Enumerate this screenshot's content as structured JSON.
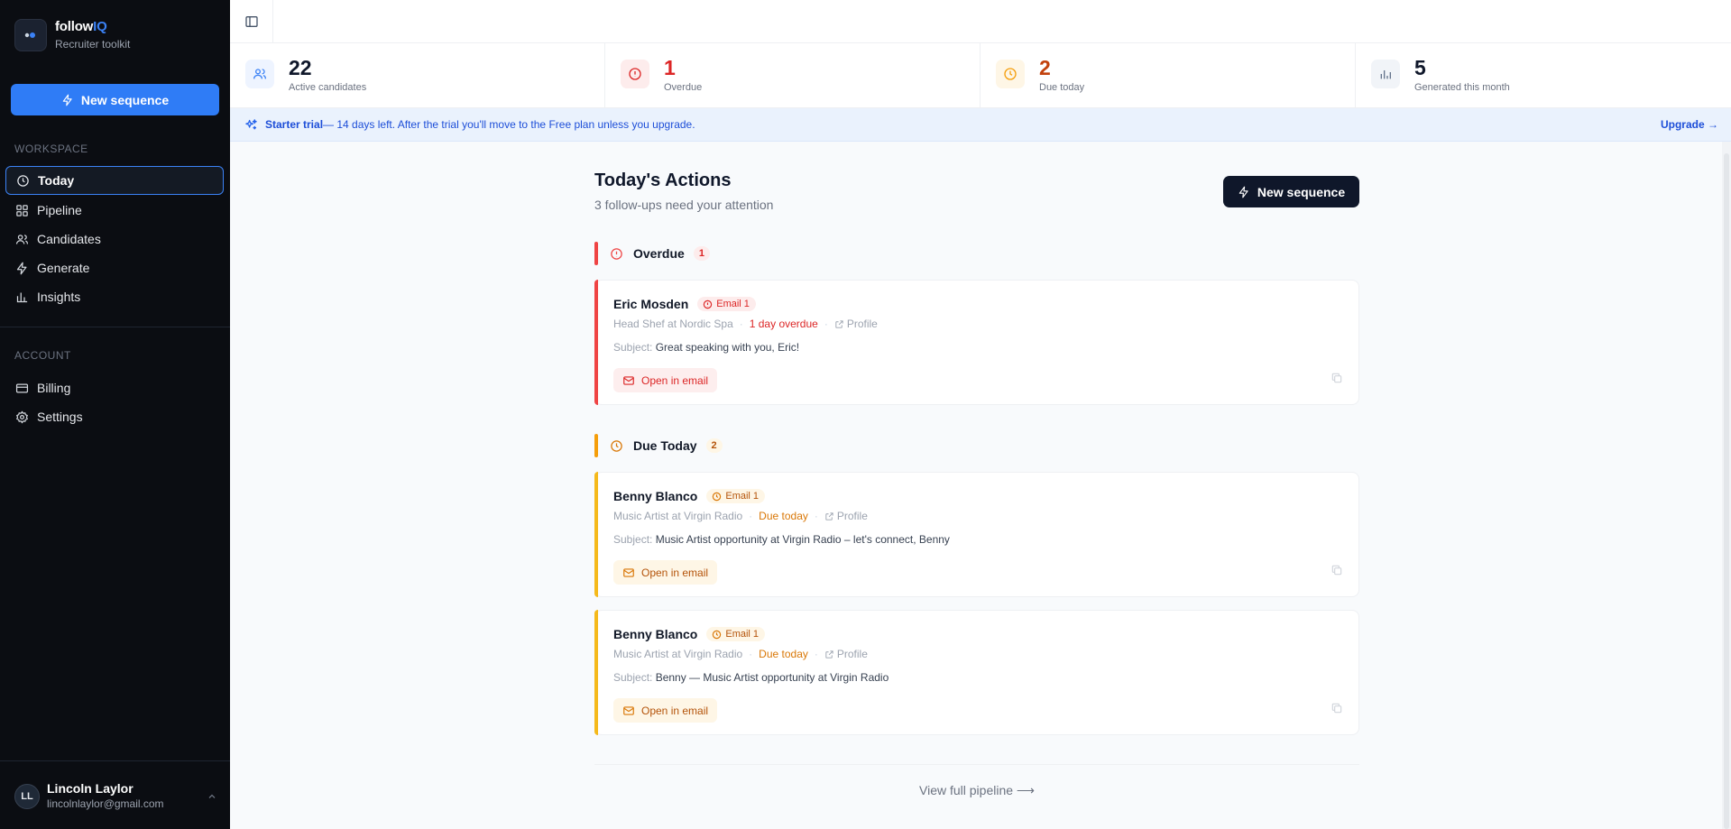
{
  "brand": {
    "name_prefix": "follow",
    "name_suffix": "IQ",
    "subtitle": "Recruiter toolkit"
  },
  "sidebar": {
    "new_sequence_label": "New sequence",
    "workspace_label": "WORKSPACE",
    "workspace_items": [
      {
        "label": "Today",
        "icon": "clock-icon",
        "active": true
      },
      {
        "label": "Pipeline",
        "icon": "grid-icon"
      },
      {
        "label": "Candidates",
        "icon": "users-icon"
      },
      {
        "label": "Generate",
        "icon": "bolt-icon"
      },
      {
        "label": "Insights",
        "icon": "bar-chart-icon"
      }
    ],
    "account_label": "ACCOUNT",
    "account_items": [
      {
        "label": "Billing",
        "icon": "credit-card-icon"
      },
      {
        "label": "Settings",
        "icon": "gear-icon"
      }
    ],
    "user": {
      "initials": "LL",
      "name": "Lincoln Laylor",
      "email": "lincolnlaylor@gmail.com"
    }
  },
  "stats": [
    {
      "value": "22",
      "label": "Active candidates",
      "icon": "users-icon",
      "color": "#0f172a"
    },
    {
      "value": "1",
      "label": "Overdue",
      "icon": "alert-circle-icon",
      "color": "#dc2626"
    },
    {
      "value": "2",
      "label": "Due today",
      "icon": "clock-icon",
      "color": "#c2410c"
    },
    {
      "value": "5",
      "label": "Generated this month",
      "icon": "bar-chart-icon",
      "color": "#0f172a"
    }
  ],
  "banner": {
    "strong": "Starter trial",
    "text": " — 14 days left. After the trial you'll move to the Free plan unless you upgrade.",
    "upgrade": "Upgrade →"
  },
  "main": {
    "title": "Today's Actions",
    "subtitle": "3 follow-ups need your attention",
    "new_sequence_label": "New sequence",
    "overdue": {
      "title": "Overdue",
      "count": "1",
      "cards": [
        {
          "name": "Eric Mosden",
          "pill": "Email 1",
          "role": "Head Shef at Nordic Spa",
          "status": "1 day overdue",
          "profile": "Profile",
          "subject_label": "Subject:",
          "subject": " Great speaking with you, Eric!",
          "open": "Open in email"
        }
      ]
    },
    "due_today": {
      "title": "Due Today",
      "count": "2",
      "cards": [
        {
          "name": "Benny Blanco",
          "pill": "Email 1",
          "role": "Music Artist at Virgin Radio",
          "status": "Due today",
          "profile": "Profile",
          "subject_label": "Subject:",
          "subject": " Music Artist opportunity at Virgin Radio – let's connect, Benny",
          "open": "Open in email"
        },
        {
          "name": "Benny Blanco",
          "pill": "Email 1",
          "role": "Music Artist at Virgin Radio",
          "status": "Due today",
          "profile": "Profile",
          "subject_label": "Subject:",
          "subject": " Benny — Music Artist opportunity at Virgin Radio",
          "open": "Open in email"
        }
      ]
    },
    "footer_link": "View full pipeline ⟶"
  },
  "colors": {
    "accent": "#2f7cf6",
    "overdue": "#ef4444",
    "due": "#f59e0b",
    "dark": "#0b0d12"
  }
}
